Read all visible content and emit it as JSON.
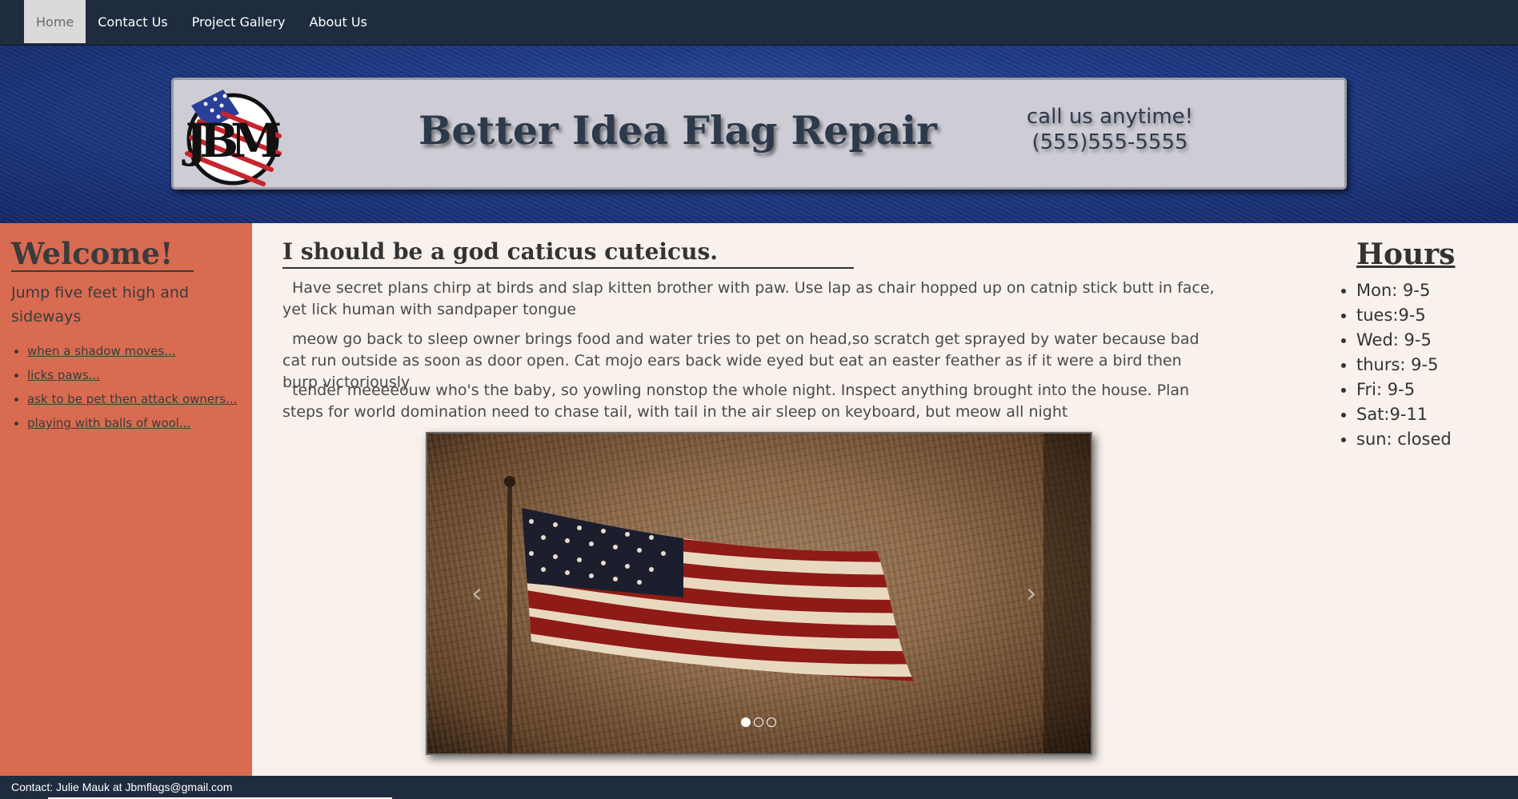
{
  "nav": {
    "items": [
      {
        "label": "Home",
        "active": true
      },
      {
        "label": "Contact Us",
        "active": false
      },
      {
        "label": "Project Gallery",
        "active": false
      },
      {
        "label": "About Us",
        "active": false
      }
    ]
  },
  "header": {
    "logo_text": "JBM",
    "title": "Better Idea Flag Repair",
    "call_line1": "call us anytime!",
    "call_line2": "(555)555-5555"
  },
  "sidebar": {
    "heading": "Welcome!",
    "tagline": "Jump five feet high and sideways",
    "links": [
      "when a shadow moves...",
      "licks paws...",
      "ask to be pet then attack owners...",
      "playing with balls of wool..."
    ]
  },
  "main": {
    "heading": "I should be a god caticus cuteicus.",
    "paragraphs": [
      "Have secret plans chirp at birds and slap kitten brother with paw. Use lap as chair hopped up on catnip stick butt in face, yet lick human with sandpaper tongue",
      "meow go back to sleep owner brings food and water tries to pet on head,so scratch get sprayed by water because bad cat run outside as soon as door open. Cat mojo ears back wide eyed but eat an easter feather as if it were a bird then burp victoriously",
      "tender meeeeouw who's the baby, so yowling nonstop the whole night. Inspect anything brought into the house. Plan steps for world domination need to chase tail, with tail in the air sleep on keyboard, but meow all night"
    ],
    "carousel": {
      "prev_glyph": "‹",
      "next_glyph": "›",
      "slide_count": 3,
      "active_index": 0
    }
  },
  "hours": {
    "title": "Hours",
    "items": [
      "Mon: 9-5",
      "tues:9-5",
      "Wed: 9-5",
      "thurs: 9-5",
      "Fri: 9-5",
      "Sat:9-11",
      "sun: closed"
    ]
  },
  "footer": {
    "contact": "Contact: Julie Mauk at Jbmflags@gmail.com"
  },
  "colors": {
    "nav_bg": "#1f2c3f",
    "header_blue": "#1f3b86",
    "sidebar_bg": "#d96b51",
    "page_bg": "#f8f1ec",
    "banner_bg": "#ceccd4",
    "text_dark": "#2d3a4c"
  }
}
